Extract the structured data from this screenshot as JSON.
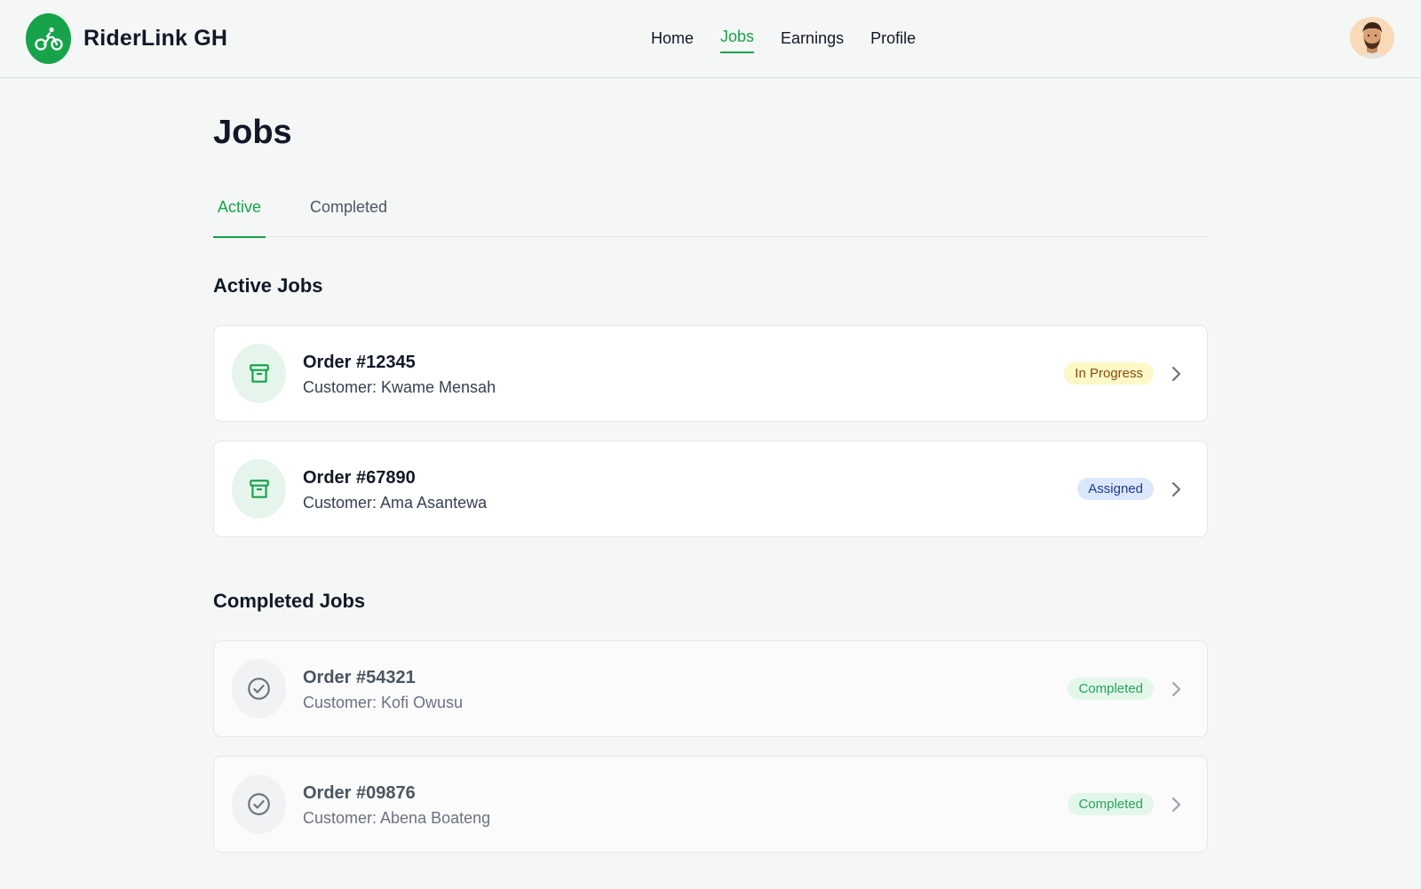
{
  "app": {
    "name": "RiderLink GH",
    "logo_icon": "bicycle-icon",
    "brand_color": "#16a34a"
  },
  "nav": {
    "items": [
      {
        "label": "Home",
        "active": false
      },
      {
        "label": "Jobs",
        "active": true
      },
      {
        "label": "Earnings",
        "active": false
      },
      {
        "label": "Profile",
        "active": false
      }
    ]
  },
  "page": {
    "title": "Jobs"
  },
  "tabs": [
    {
      "label": "Active",
      "active": true
    },
    {
      "label": "Completed",
      "active": false
    }
  ],
  "sections": {
    "active": {
      "title": "Active Jobs",
      "jobs": [
        {
          "order": "Order #12345",
          "customer": "Customer: Kwame Mensah",
          "status": "In Progress",
          "icon": "archive-box-icon"
        },
        {
          "order": "Order #67890",
          "customer": "Customer: Ama Asantewa",
          "status": "Assigned",
          "icon": "archive-box-icon"
        }
      ]
    },
    "completed": {
      "title": "Completed Jobs",
      "jobs": [
        {
          "order": "Order #54321",
          "customer": "Customer: Kofi Owusu",
          "status": "Completed",
          "icon": "check-circle-icon"
        },
        {
          "order": "Order #09876",
          "customer": "Customer: Abena Boateng",
          "status": "Completed",
          "icon": "check-circle-icon"
        }
      ]
    }
  },
  "status_colors": {
    "in_progress": "#fef7c6",
    "assigned": "#dbe7fd",
    "completed": "#e3f6ea"
  }
}
